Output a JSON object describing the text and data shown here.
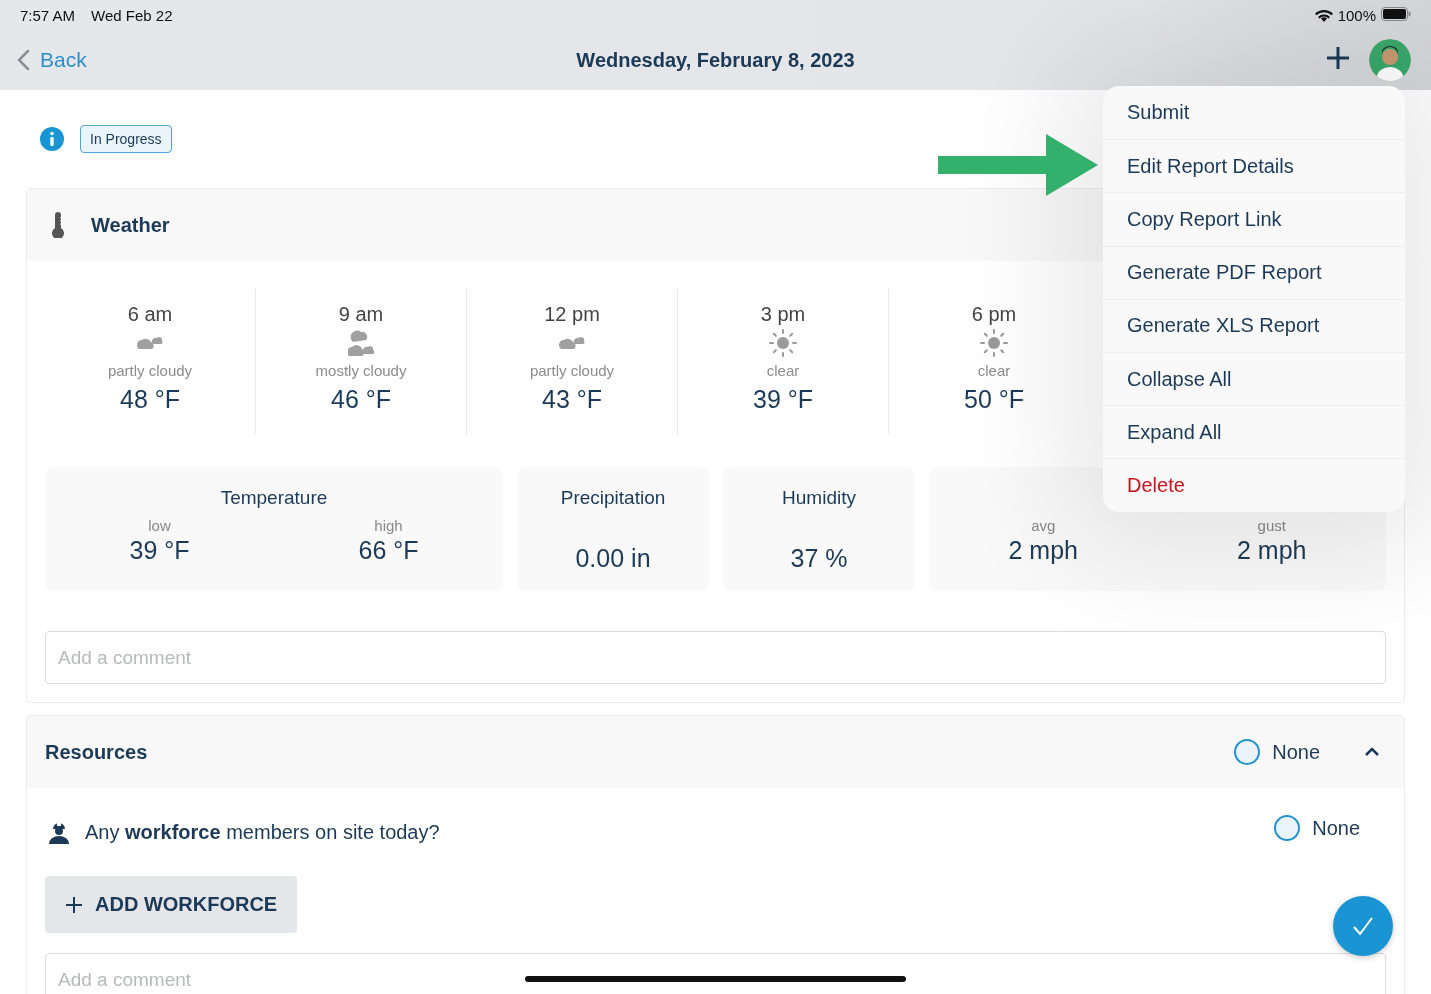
{
  "status_bar": {
    "time": "7:57 AM",
    "date": "Wed Feb 22",
    "battery": "100%"
  },
  "nav": {
    "back": "Back",
    "title": "Wednesday, February 8, 2023"
  },
  "status_badge": "In Progress",
  "weather": {
    "title": "Weather",
    "hours": [
      {
        "time": "6 am",
        "kind": "partly-cloudy",
        "condition": "partly cloudy",
        "temp": "48 °F"
      },
      {
        "time": "9 am",
        "kind": "mostly-cloudy",
        "condition": "mostly cloudy",
        "temp": "46 °F"
      },
      {
        "time": "12 pm",
        "kind": "partly-cloudy",
        "condition": "partly cloudy",
        "temp": "43 °F"
      },
      {
        "time": "3 pm",
        "kind": "clear",
        "condition": "clear",
        "temp": "39 °F"
      },
      {
        "time": "6 pm",
        "kind": "clear",
        "condition": "clear",
        "temp": "50 °F"
      }
    ],
    "stats": [
      {
        "kind": "pair",
        "title": "Temperature",
        "values": [
          {
            "label": "low",
            "value": "39 °F"
          },
          {
            "label": "high",
            "value": "66 °F"
          }
        ]
      },
      {
        "kind": "single",
        "title": "Precipitation",
        "value": "0.00 in"
      },
      {
        "kind": "single",
        "title": "Humidity",
        "value": "37 %"
      },
      {
        "kind": "pair",
        "values": [
          {
            "label": "avg",
            "value": "2 mph"
          },
          {
            "label": "gust",
            "value": "2 mph"
          }
        ]
      }
    ],
    "comment_placeholder": "Add a comment"
  },
  "resources": {
    "title": "Resources",
    "expanded": true,
    "option": {
      "label": "None",
      "selected": false
    },
    "questions": [
      {
        "text": "Any **workforce** members on site today?",
        "option": {
          "label": "None",
          "selected": false
        }
      }
    ],
    "add_button": "ADD WORKFORCE",
    "comment_placeholder": "Add a comment"
  },
  "menu": {
    "items": [
      {
        "label": "Submit",
        "kind": "normal",
        "pointed": false
      },
      {
        "label": "Edit Report Details",
        "kind": "normal",
        "pointed": true
      },
      {
        "label": "Copy Report Link",
        "kind": "normal",
        "pointed": false
      },
      {
        "label": "Generate PDF Report",
        "kind": "normal",
        "pointed": false
      },
      {
        "label": "Generate XLS Report",
        "kind": "normal",
        "pointed": false
      },
      {
        "label": "Collapse All",
        "kind": "normal",
        "pointed": false
      },
      {
        "label": "Expand All",
        "kind": "normal",
        "pointed": false
      },
      {
        "label": "Delete",
        "kind": "destructive",
        "pointed": false
      }
    ]
  }
}
